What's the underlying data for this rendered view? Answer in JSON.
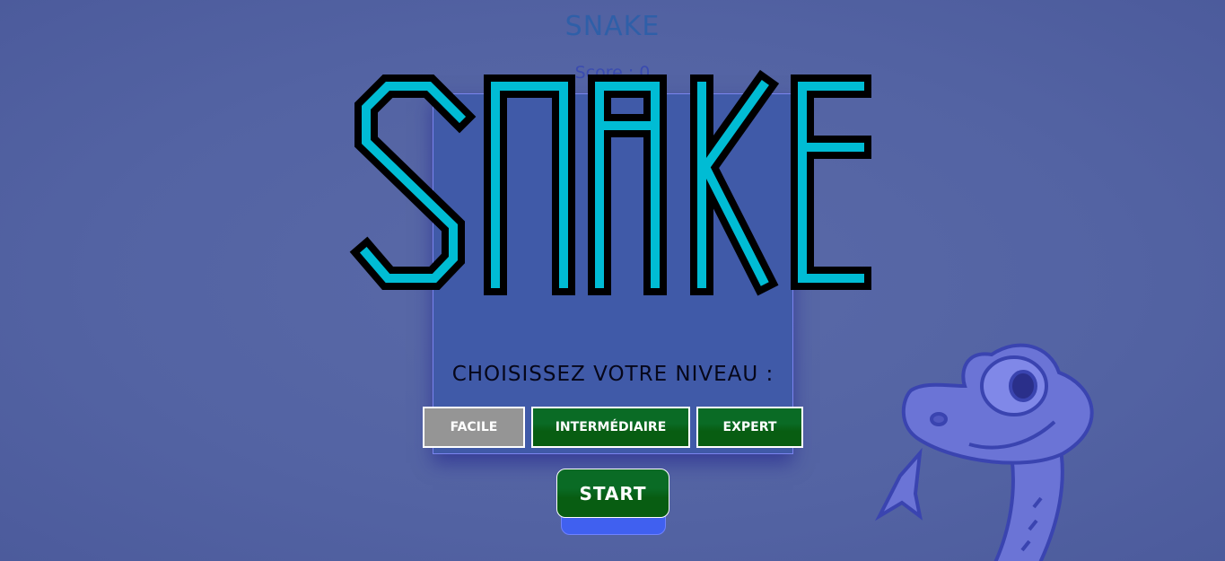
{
  "header": {
    "title": "SNAKE",
    "score": "Score : 0"
  },
  "logo": {
    "text": "SNAKE"
  },
  "menu": {
    "prompt": "CHOISISSEZ VOTRE NIVEAU :",
    "levels": [
      {
        "label": "FACILE",
        "selected": true
      },
      {
        "label": "INTERMÉDIAIRE",
        "selected": false
      },
      {
        "label": "EXPERT",
        "selected": false
      }
    ],
    "start_label": "START"
  },
  "colors": {
    "logo_fill": "#00bcd4",
    "logo_outline": "#000000",
    "button_green": "#0a6b25",
    "selected_grey": "#959595"
  }
}
